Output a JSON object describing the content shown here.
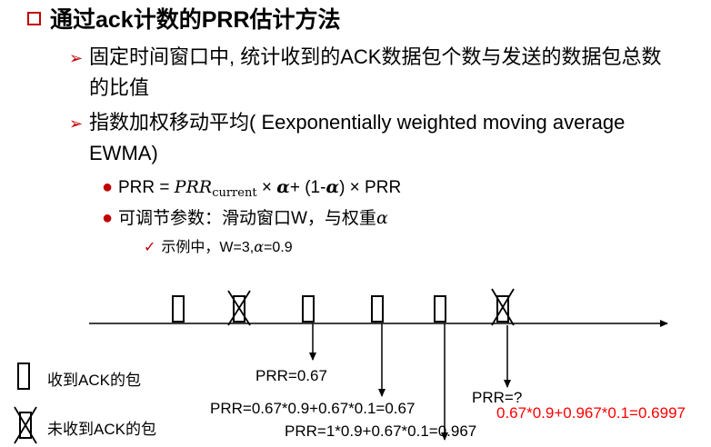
{
  "title": "通过ack计数的PRR估计方法",
  "bullets": [
    {
      "line1": "固定时间窗口中, 统计收到的ACK数据包个数与发送的数据包总数",
      "line2": "的比值"
    },
    {
      "line1": "指数加权移动平均( Eexponentially weighted moving average",
      "line2": "EWMA)"
    }
  ],
  "formula": {
    "lhs": "PRR = ",
    "prr_var": "PRR",
    "sub": "current",
    "times1": " × ",
    "alpha1": "α",
    "plus": "+ (1-",
    "alpha2": "α",
    "rest": ") × PRR"
  },
  "tunable": {
    "text": "可调节参数：滑动窗口W，与权重",
    "alpha": "α"
  },
  "example": {
    "prefix": "示例中，W=3,",
    "alpha": "α",
    "suffix": "=0.9"
  },
  "annotations": {
    "prr1": "PRR=0.67",
    "prr2": "PRR=0.67*0.9+0.67*0.1=0.67",
    "prr3": "PRR=1*0.9+0.67*0.1=0.967",
    "prr4_label": "PRR=?",
    "prr4_value": "0.67*0.9+0.967*0.1=0.6997"
  },
  "legend": {
    "received": "收到ACK的包",
    "not_received": "未收到ACK的包"
  },
  "colors": {
    "accent": "#c00000",
    "highlight": "#ff0000"
  }
}
